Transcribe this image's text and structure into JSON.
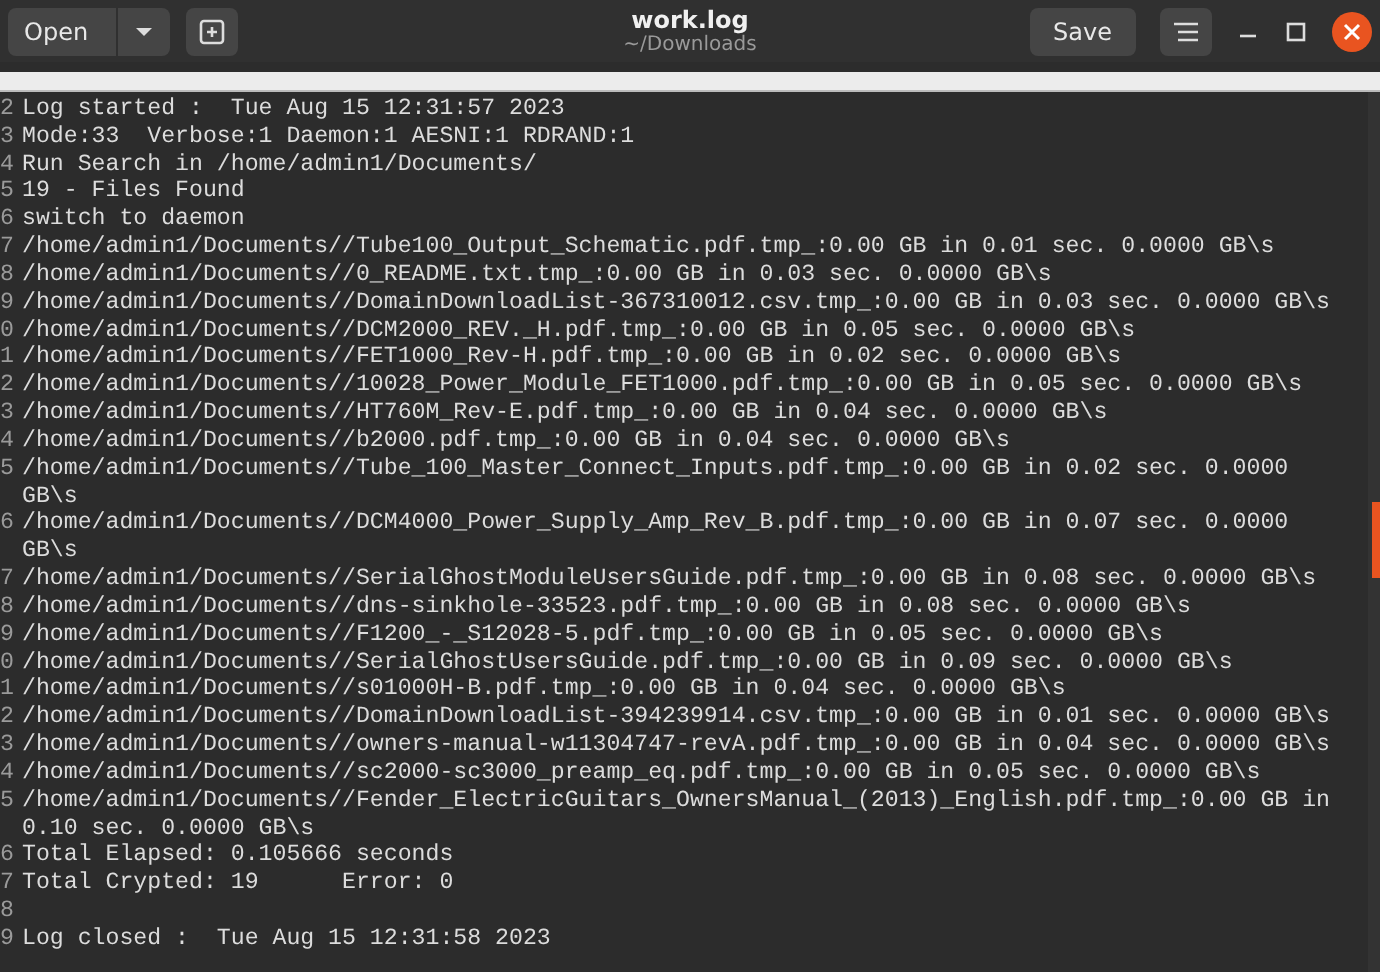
{
  "header": {
    "open_button": "Open",
    "title": "work.log",
    "subtitle": "~/Downloads",
    "save_button": "Save"
  },
  "lines": [
    {
      "number": "2",
      "text": "Log started :  Tue Aug 15 12:31:57 2023"
    },
    {
      "number": "3",
      "text": "Mode:33  Verbose:1 Daemon:1 AESNI:1 RDRAND:1"
    },
    {
      "number": "4",
      "text": "Run Search in /home/admin1/Documents/"
    },
    {
      "number": "5",
      "text": "19 - Files Found"
    },
    {
      "number": "6",
      "text": "switch to daemon"
    },
    {
      "number": "7",
      "text": "/home/admin1/Documents//Tube100_Output_Schematic.pdf.tmp_:0.00 GB in 0.01 sec. 0.0000 GB\\s"
    },
    {
      "number": "8",
      "text": "/home/admin1/Documents//0_README.txt.tmp_:0.00 GB in 0.03 sec. 0.0000 GB\\s"
    },
    {
      "number": "9",
      "text": "/home/admin1/Documents//DomainDownloadList-367310012.csv.tmp_:0.00 GB in 0.03 sec. 0.0000 GB\\s"
    },
    {
      "number": "0",
      "text": "/home/admin1/Documents//DCM2000_REV._H.pdf.tmp_:0.00 GB in 0.05 sec. 0.0000 GB\\s"
    },
    {
      "number": "1",
      "text": "/home/admin1/Documents//FET1000_Rev-H.pdf.tmp_:0.00 GB in 0.02 sec. 0.0000 GB\\s"
    },
    {
      "number": "2",
      "text": "/home/admin1/Documents//10028_Power_Module_FET1000.pdf.tmp_:0.00 GB in 0.05 sec. 0.0000 GB\\s"
    },
    {
      "number": "3",
      "text": "/home/admin1/Documents//HT760M_Rev-E.pdf.tmp_:0.00 GB in 0.04 sec. 0.0000 GB\\s"
    },
    {
      "number": "4",
      "text": "/home/admin1/Documents//b2000.pdf.tmp_:0.00 GB in 0.04 sec. 0.0000 GB\\s"
    },
    {
      "number": "5",
      "text": "/home/admin1/Documents//Tube_100_Master_Connect_Inputs.pdf.tmp_:0.00 GB in 0.02 sec. 0.0000 GB\\s"
    },
    {
      "number": "6",
      "text": "/home/admin1/Documents//DCM4000_Power_Supply_Amp_Rev_B.pdf.tmp_:0.00 GB in 0.07 sec. 0.0000 GB\\s"
    },
    {
      "number": "7",
      "text": "/home/admin1/Documents//SerialGhostModuleUsersGuide.pdf.tmp_:0.00 GB in 0.08 sec. 0.0000 GB\\s"
    },
    {
      "number": "8",
      "text": "/home/admin1/Documents//dns-sinkhole-33523.pdf.tmp_:0.00 GB in 0.08 sec. 0.0000 GB\\s"
    },
    {
      "number": "9",
      "text": "/home/admin1/Documents//F1200_-_S12028-5.pdf.tmp_:0.00 GB in 0.05 sec. 0.0000 GB\\s"
    },
    {
      "number": "0",
      "text": "/home/admin1/Documents//SerialGhostUsersGuide.pdf.tmp_:0.00 GB in 0.09 sec. 0.0000 GB\\s"
    },
    {
      "number": "1",
      "text": "/home/admin1/Documents//s01000H-B.pdf.tmp_:0.00 GB in 0.04 sec. 0.0000 GB\\s"
    },
    {
      "number": "2",
      "text": "/home/admin1/Documents//DomainDownloadList-394239914.csv.tmp_:0.00 GB in 0.01 sec. 0.0000 GB\\s"
    },
    {
      "number": "3",
      "text": "/home/admin1/Documents//owners-manual-w11304747-revA.pdf.tmp_:0.00 GB in 0.04 sec. 0.0000 GB\\s"
    },
    {
      "number": "4",
      "text": "/home/admin1/Documents//sc2000-sc3000_preamp_eq.pdf.tmp_:0.00 GB in 0.05 sec. 0.0000 GB\\s"
    },
    {
      "number": "5",
      "text": "/home/admin1/Documents//Fender_ElectricGuitars_OwnersManual_(2013)_English.pdf.tmp_:0.00 GB in 0.10 sec. 0.0000 GB\\s"
    },
    {
      "number": "6",
      "text": "Total Elapsed: 0.105666 seconds"
    },
    {
      "number": "7",
      "text": "Total Crypted: 19      Error: 0"
    },
    {
      "number": "8"
    },
    {
      "number": "9",
      "text": "Log closed :  Tue Aug 15 12:31:58 2023"
    }
  ]
}
